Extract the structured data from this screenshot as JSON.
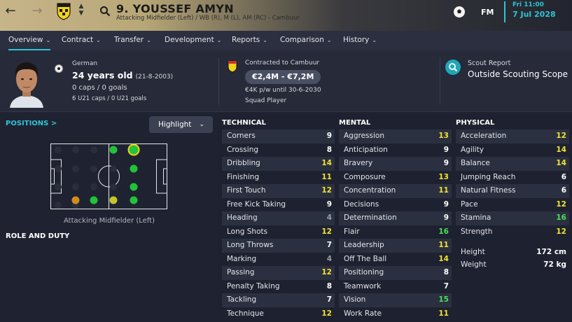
{
  "header": {
    "player_name": "9. YOUSSEF AMYN",
    "subtitle": "Attacking Midfielder (Left) / WB (R), M (L), AM (RC) - Cambuur",
    "brand": "FM",
    "date_day": "Fri 11:00",
    "date_full": "7 Jul 2028",
    "icons": [
      "back-arrow-icon",
      "forward-arrow-icon",
      "club-crest-icon",
      "search-icon",
      "football-icon"
    ]
  },
  "nav": {
    "items": [
      {
        "label": "Overview"
      },
      {
        "label": "Contract"
      },
      {
        "label": "Transfer"
      },
      {
        "label": "Development"
      },
      {
        "label": "Reports"
      },
      {
        "label": "Comparison"
      },
      {
        "label": "History"
      }
    ],
    "active": "Overview"
  },
  "info": {
    "nationality": "German",
    "age": "24 years old",
    "dob": "(21-8-2003)",
    "caps": "0 caps / 0 goals",
    "u21": "6 U21 caps / 0 U21 goals",
    "contracted": "Contracted to Cambuur",
    "value": "€2,4M - €7,2M",
    "wage": "€4K p/w until 30-6-2030",
    "squad_status": "Squad Player",
    "scout_title": "Scout Report",
    "scout_value": "Outside Scouting Scope"
  },
  "positions": {
    "title": "POSITIONS >",
    "dropdown": "Highlight",
    "role_label": "Attacking Midfielder (Left)",
    "role_duty": "ROLE AND DUTY",
    "colors": {
      "natural": "#22c33a",
      "accomplished": "#22c33a",
      "unconvincing": "#c2c62a",
      "awkward": "#d08c1e"
    }
  },
  "technical": {
    "title": "TECHNICAL",
    "attrs": [
      {
        "name": "Corners",
        "value": "9"
      },
      {
        "name": "Crossing",
        "value": "8"
      },
      {
        "name": "Dribbling",
        "value": "14"
      },
      {
        "name": "Finishing",
        "value": "11"
      },
      {
        "name": "First Touch",
        "value": "12"
      },
      {
        "name": "Free Kick Taking",
        "value": "9"
      },
      {
        "name": "Heading",
        "value": "4"
      },
      {
        "name": "Long Shots",
        "value": "12"
      },
      {
        "name": "Long Throws",
        "value": "7"
      },
      {
        "name": "Marking",
        "value": "4"
      },
      {
        "name": "Passing",
        "value": "12"
      },
      {
        "name": "Penalty Taking",
        "value": "8"
      },
      {
        "name": "Tackling",
        "value": "7"
      },
      {
        "name": "Technique",
        "value": "12"
      }
    ]
  },
  "mental": {
    "title": "MENTAL",
    "attrs": [
      {
        "name": "Aggression",
        "value": "13"
      },
      {
        "name": "Anticipation",
        "value": "9"
      },
      {
        "name": "Bravery",
        "value": "9"
      },
      {
        "name": "Composure",
        "value": "13"
      },
      {
        "name": "Concentration",
        "value": "11"
      },
      {
        "name": "Decisions",
        "value": "9"
      },
      {
        "name": "Determination",
        "value": "9"
      },
      {
        "name": "Flair",
        "value": "16"
      },
      {
        "name": "Leadership",
        "value": "11"
      },
      {
        "name": "Off The Ball",
        "value": "14"
      },
      {
        "name": "Positioning",
        "value": "8"
      },
      {
        "name": "Teamwork",
        "value": "7"
      },
      {
        "name": "Vision",
        "value": "15"
      },
      {
        "name": "Work Rate",
        "value": "11"
      }
    ]
  },
  "physical": {
    "title": "PHYSICAL",
    "attrs": [
      {
        "name": "Acceleration",
        "value": "12"
      },
      {
        "name": "Agility",
        "value": "14"
      },
      {
        "name": "Balance",
        "value": "14"
      },
      {
        "name": "Jumping Reach",
        "value": "6"
      },
      {
        "name": "Natural Fitness",
        "value": "6"
      },
      {
        "name": "Pace",
        "value": "12"
      },
      {
        "name": "Stamina",
        "value": "16"
      },
      {
        "name": "Strength",
        "value": "12"
      }
    ],
    "height_label": "Height",
    "height": "172 cm",
    "weight_label": "Weight",
    "weight": "72 kg"
  }
}
